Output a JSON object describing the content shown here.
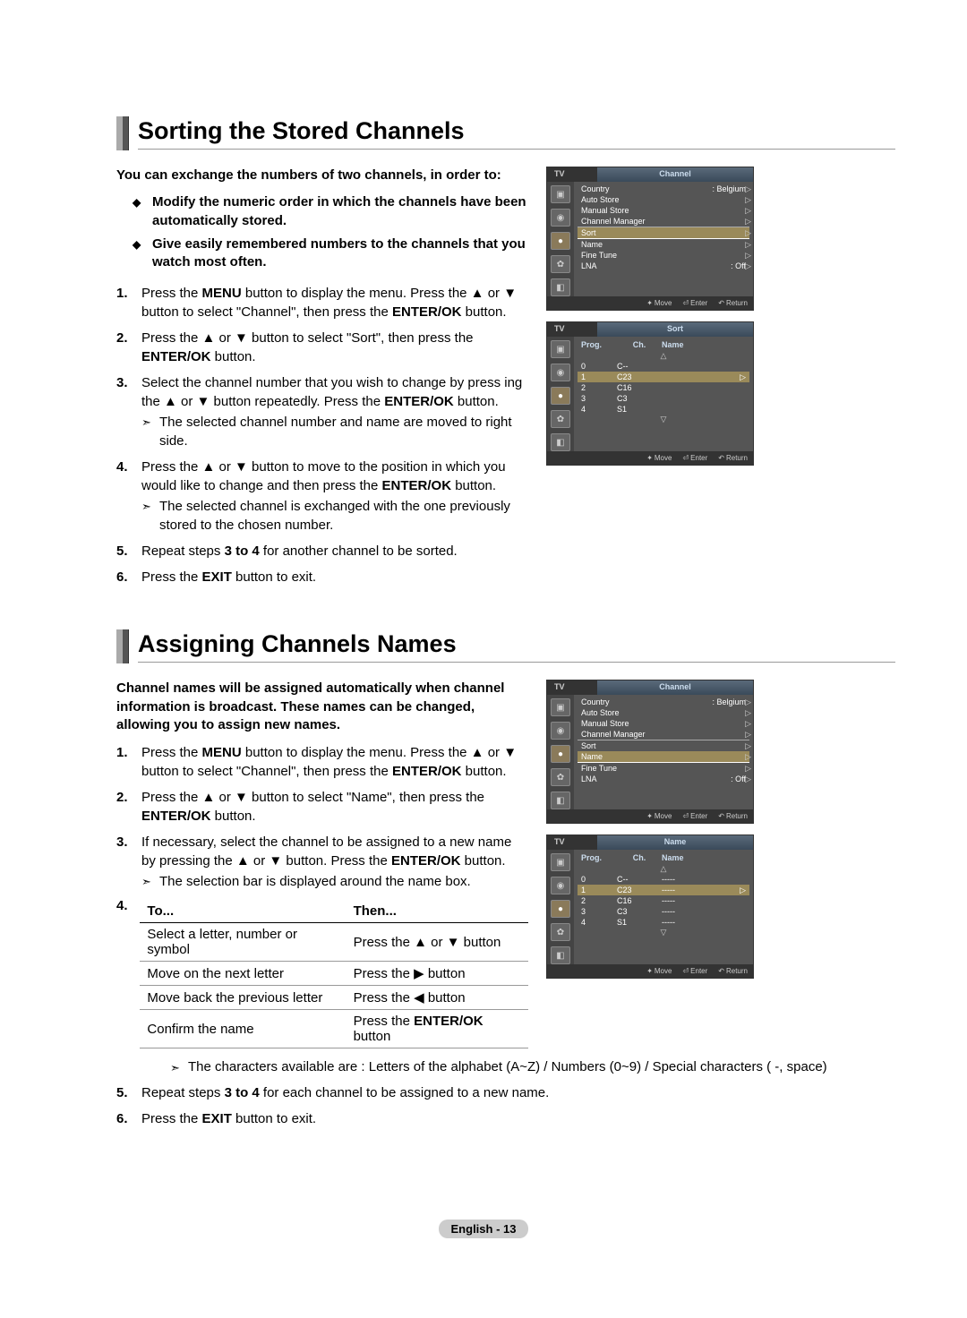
{
  "section1": {
    "title": "Sorting the Stored Channels",
    "intro": "You can exchange the numbers of two channels, in order to:",
    "bullets": [
      "Modify the numeric order in which the channels have been automatically stored.",
      "Give easily remembered numbers to the channels that you watch most often."
    ],
    "steps": [
      {
        "n": "1.",
        "t": "Press the MENU button to display the menu.  Press the ▲ or ▼ button to select \"Channel\", then press the ENTER/OK button."
      },
      {
        "n": "2.",
        "t": "Press the ▲ or ▼ button to select \"Sort\", then press the ENTER/OK button."
      },
      {
        "n": "3.",
        "t": "Select the channel number that you wish to change by press ing the ▲ or ▼ button repeatedly. Press the ENTER/OK button.",
        "note": "The selected channel number and name are moved to right side."
      },
      {
        "n": "4.",
        "t": "Press the ▲ or ▼ button to move to the position in which you would like to change and then press the  ENTER/OK button.",
        "note": "The selected channel is exchanged with the one previously stored to the chosen number."
      },
      {
        "n": "5.",
        "t": "Repeat steps 3 to 4 for another channel to be sorted."
      },
      {
        "n": "6.",
        "t": "Press the EXIT button to exit."
      }
    ]
  },
  "section2": {
    "title": "Assigning Channels Names",
    "intro": "Channel names will be assigned automatically when channel information is broadcast. These names can be changed, allowing you to assign new names.",
    "steps": [
      {
        "n": "1.",
        "t": "Press the MENU button to display the menu. Press the ▲ or ▼ button to select \"Channel\", then press the ENTER/OK button."
      },
      {
        "n": "2.",
        "t": "Press the ▲ or ▼ button to select \"Name\", then press the ENTER/OK button."
      },
      {
        "n": "3.",
        "t": "If necessary, select the channel to be assigned to a new name by pressing the ▲ or ▼ button. Press the ENTER/OK button.",
        "note": "The selection bar is displayed around the name box."
      }
    ],
    "tableHead": {
      "n": "4.",
      "c1": "To...",
      "c2": "Then..."
    },
    "tableRows": [
      {
        "c1": "Select a letter, number or symbol",
        "c2": "Press the ▲ or ▼ button"
      },
      {
        "c1": "Move on the next letter",
        "c2": "Press the ▶ button"
      },
      {
        "c1": "Move back the previous letter",
        "c2": "Press the ◀ button"
      },
      {
        "c1": "Confirm the name",
        "c2": "Press the ENTER/OK button"
      }
    ],
    "afterNote": "The characters available are : Letters of the alphabet (A~Z) / Numbers (0~9) / Special characters ( -, space)",
    "steps2": [
      {
        "n": "5.",
        "t": "Repeat steps 3 to 4 for each channel to be assigned to a new name."
      },
      {
        "n": "6.",
        "t": "Press the EXIT button to exit."
      }
    ]
  },
  "tvmenu": {
    "tvLabel": "TV",
    "channelTitle": "Channel",
    "sortTitle": "Sort",
    "nameTitle": "Name",
    "items": [
      {
        "label": "Country",
        "value": ": Belgium",
        "arrow": true
      },
      {
        "label": "Auto Store",
        "value": "",
        "arrow": true
      },
      {
        "label": "Manual Store",
        "value": "",
        "arrow": true
      },
      {
        "label": "Channel Manager",
        "value": "",
        "arrow": true,
        "underline": true
      },
      {
        "label": "Sort",
        "value": "",
        "arrow": true
      },
      {
        "label": "Name",
        "value": "",
        "arrow": true
      },
      {
        "label": "Fine Tune",
        "value": "",
        "arrow": true
      },
      {
        "label": "LNA",
        "value": ": Off",
        "arrow": true
      }
    ],
    "hlSort": "Sort",
    "hlName": "Name",
    "sortHead": {
      "c1": "Prog.",
      "c2": "Ch.",
      "c3": "Name"
    },
    "sortRows": [
      {
        "p": "0",
        "c": "C--",
        "n": ""
      },
      {
        "p": "1",
        "c": "C23",
        "n": "",
        "sel": true
      },
      {
        "p": "2",
        "c": "C16",
        "n": ""
      },
      {
        "p": "3",
        "c": "C3",
        "n": ""
      },
      {
        "p": "4",
        "c": "S1",
        "n": ""
      }
    ],
    "nameRows": [
      {
        "p": "0",
        "c": "C--",
        "n": "-----"
      },
      {
        "p": "1",
        "c": "C23",
        "n": "-----",
        "sel": true
      },
      {
        "p": "2",
        "c": "C16",
        "n": "-----"
      },
      {
        "p": "3",
        "c": "C3",
        "n": "-----"
      },
      {
        "p": "4",
        "c": "S1",
        "n": "-----"
      }
    ],
    "footer": {
      "move": "Move",
      "enter": "Enter",
      "return": "Return"
    }
  },
  "footer": "English - 13"
}
